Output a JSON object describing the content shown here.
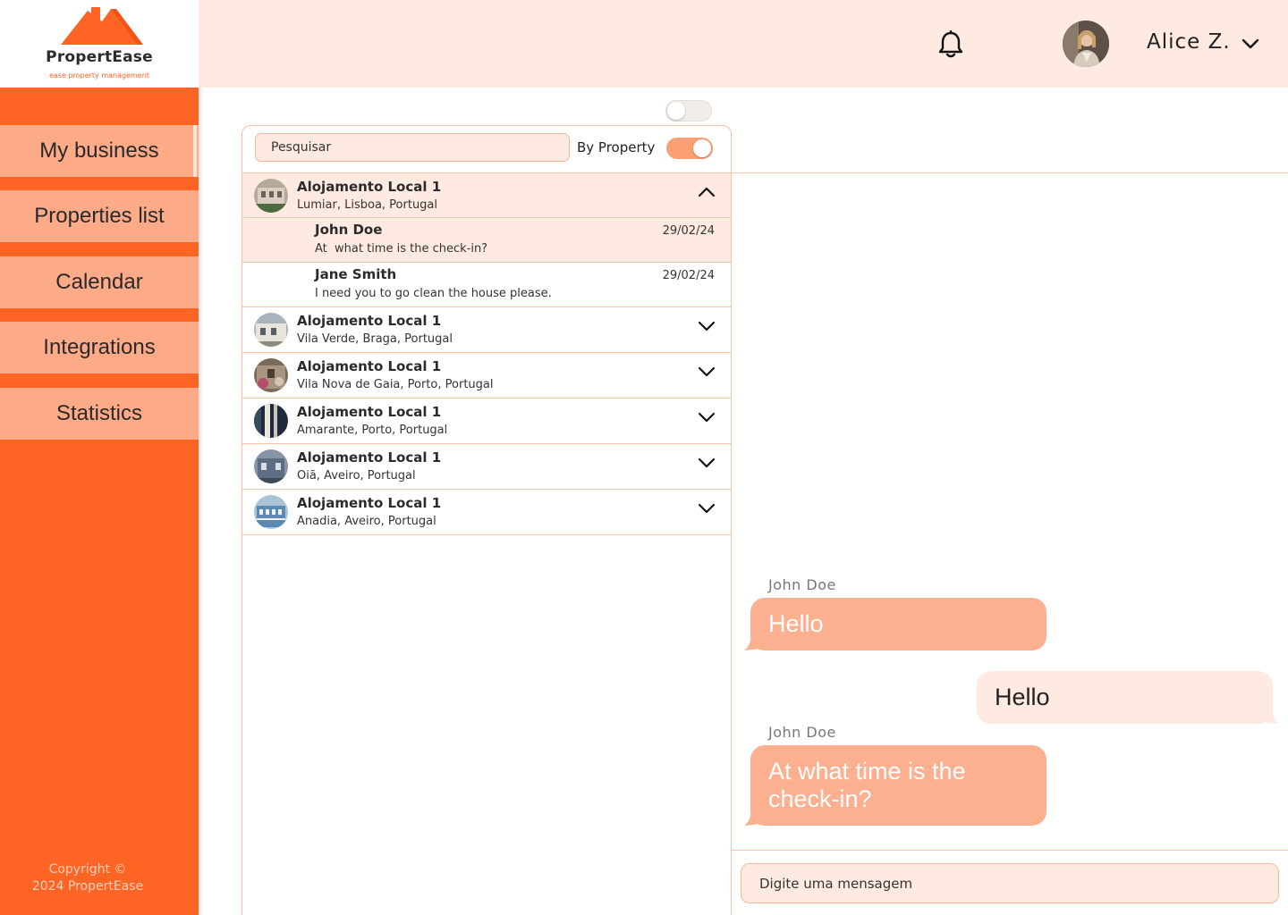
{
  "brand": {
    "name": "PropertEase",
    "tagline": "ease property management",
    "accent": "#fe6424",
    "accent_light": "#fdaa88",
    "header_bg": "#ffeae1"
  },
  "sidebar": {
    "items": [
      {
        "label": "My business",
        "active": true
      },
      {
        "label": "Properties list",
        "active": false
      },
      {
        "label": "Calendar",
        "active": false
      },
      {
        "label": "Integrations",
        "active": false
      },
      {
        "label": "Statistics",
        "active": false
      }
    ],
    "copyright_line1": "Copyright ©",
    "copyright_line2": "2024 PropertEase"
  },
  "header": {
    "notification_icon": "bell-icon",
    "user_name": "Alice Z.",
    "user_menu_icon": "chevron-down-icon"
  },
  "inbox": {
    "top_toggle_on": false,
    "search_placeholder": "Pesquisar",
    "by_property_label": "By Property",
    "by_property_on": true,
    "properties": [
      {
        "title": "Alojamento Local 1",
        "location": "Lumiar, Lisboa, Portugal",
        "expanded": true,
        "messages": [
          {
            "name": "John Doe",
            "date": "29/02/24",
            "preview": "At  what time is the check-in?",
            "unread": true
          },
          {
            "name": "Jane Smith",
            "date": "29/02/24",
            "preview": "I need you to go clean the house please.",
            "unread": false
          }
        ]
      },
      {
        "title": "Alojamento Local 1",
        "location": "Vila Verde, Braga, Portugal",
        "expanded": false
      },
      {
        "title": "Alojamento Local 1",
        "location": "Vila Nova de Gaia, Porto, Portugal",
        "expanded": false
      },
      {
        "title": "Alojamento Local 1",
        "location": "Amarante, Porto, Portugal",
        "expanded": false
      },
      {
        "title": "Alojamento Local 1",
        "location": "Oiã, Aveiro, Portugal",
        "expanded": false
      },
      {
        "title": "Alojamento Local 1",
        "location": "Anadia, Aveiro, Portugal",
        "expanded": false
      }
    ]
  },
  "chat": {
    "messages": [
      {
        "sender": "John Doe",
        "text": "Hello",
        "direction": "incoming"
      },
      {
        "sender": "",
        "text": "Hello",
        "direction": "outgoing"
      },
      {
        "sender": "John Doe",
        "text": "At what time is the check-in?",
        "direction": "incoming"
      }
    ],
    "compose_placeholder": "Digite uma mensagem"
  }
}
